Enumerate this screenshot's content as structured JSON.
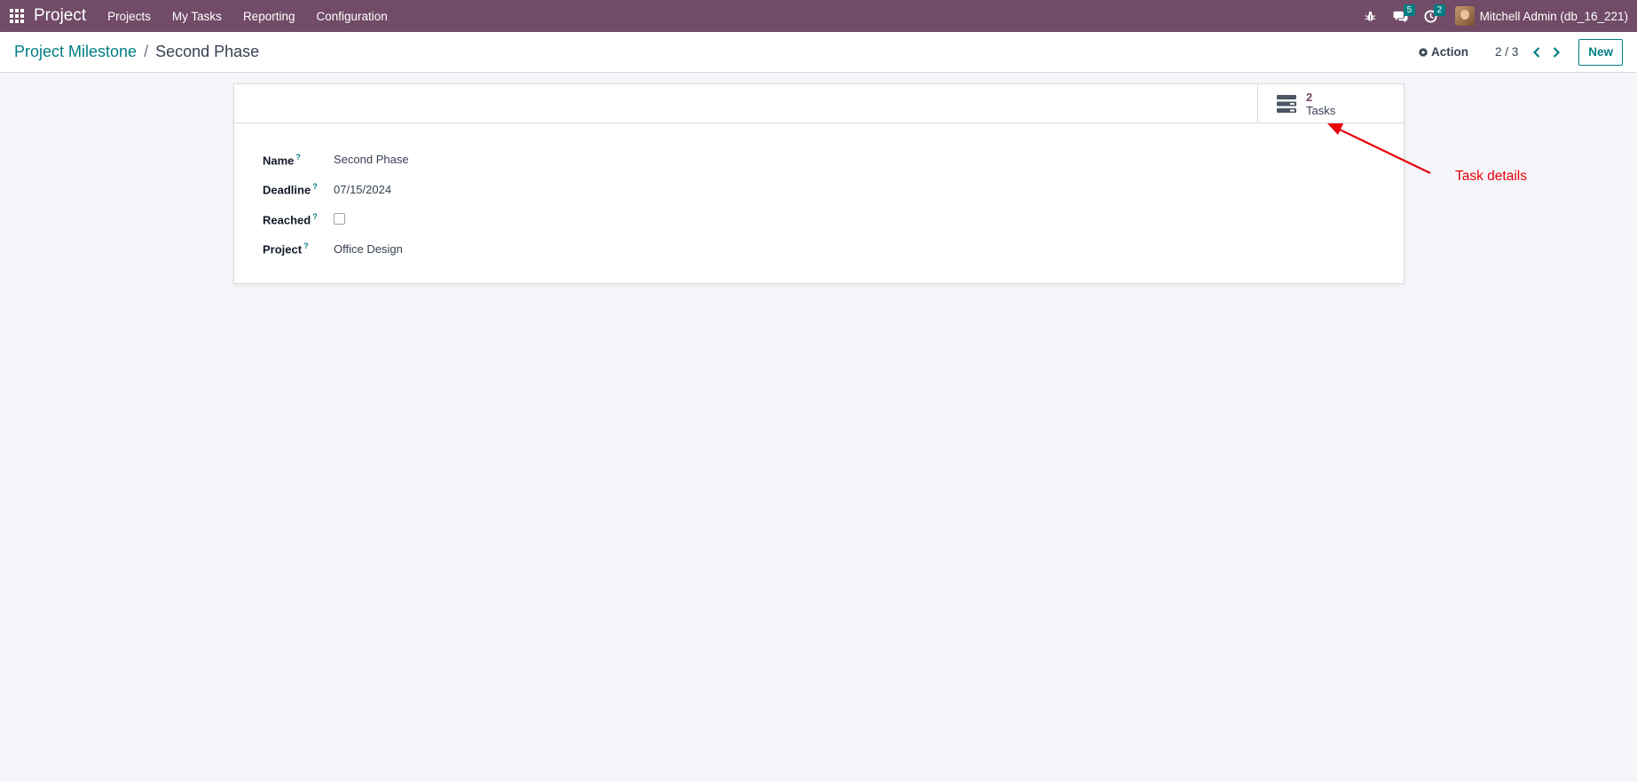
{
  "navbar": {
    "brand": "Project",
    "menu": [
      "Projects",
      "My Tasks",
      "Reporting",
      "Configuration"
    ],
    "messages_badge": "5",
    "activities_badge": "2",
    "user_name": "Mitchell Admin (db_16_221)"
  },
  "control_panel": {
    "breadcrumb_parent": "Project Milestone",
    "breadcrumb_separator": "/",
    "breadcrumb_current": "Second Phase",
    "action_label": "Action",
    "pager": "2 / 3",
    "new_label": "New"
  },
  "smart_button": {
    "value": "2",
    "label": "Tasks"
  },
  "form": {
    "fields": [
      {
        "label": "Name",
        "help": "?",
        "value": "Second Phase"
      },
      {
        "label": "Deadline",
        "help": "?",
        "value": "07/15/2024"
      },
      {
        "label": "Reached",
        "help": "?",
        "checked": false
      },
      {
        "label": "Project",
        "help": "?",
        "value": "Office Design"
      }
    ]
  },
  "annotation": {
    "text": "Task details",
    "color": "#e8000b"
  },
  "colors": {
    "navbar": "#714b67",
    "accent": "#017e84",
    "background": "#f5f6f9"
  }
}
